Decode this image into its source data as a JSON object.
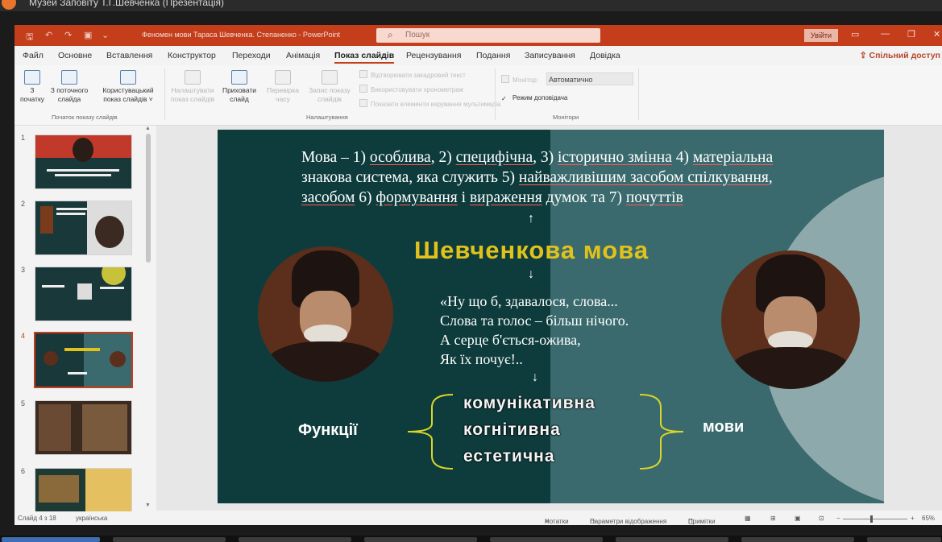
{
  "meeting": {
    "title": "Музей Заповіту Т.Г.Шевченка (Презентація)"
  },
  "app": {
    "doc_title": "Феномен мови Тараса Шевченка. Степаненко  -  PowerPoint",
    "search_placeholder": "Пошук",
    "sign_in": "Увійти"
  },
  "tabs": [
    "Файл",
    "Основне",
    "Вставлення",
    "Конструктор",
    "Переходи",
    "Анімація",
    "Показ слайдів",
    "Рецензування",
    "Подання",
    "Записування",
    "Довідка"
  ],
  "active_tab": "Показ слайдів",
  "share_label": "Спільний доступ",
  "ribbon": {
    "start": {
      "from_beginning": "З\nпочатку",
      "from_current": "З поточного\nслайда",
      "custom": "Користувацький\nпоказ слайдів ˅",
      "group": "Початок показу слайдів"
    },
    "setup": {
      "setup_show": "Налаштувати\nпоказ слайдів",
      "hide_slide": "Приховати\nслайд",
      "rehearse": "Перевірка\nчасу",
      "record": "Запис показу\nслайдів",
      "options": [
        "Відтворювати закадровий текст",
        "Використовувати хронометраж",
        "Показати елементи керування мультимедіа"
      ],
      "group": "Налаштування"
    },
    "monitors": {
      "monitor_label": "Монітор:",
      "monitor_value": "Автоматично",
      "presenter_view": "Режим доповідача",
      "group": "Монітори"
    }
  },
  "thumbnails": [
    {
      "num": "1",
      "selected": false
    },
    {
      "num": "2",
      "selected": false
    },
    {
      "num": "3",
      "selected": false
    },
    {
      "num": "4",
      "selected": true
    },
    {
      "num": "5",
      "selected": false
    },
    {
      "num": "6",
      "selected": false
    }
  ],
  "slide": {
    "line1_prefix": "Мова –  1) ",
    "w1": "особлива",
    "s1": ", 2) ",
    "w2": "специфічна",
    "s2": ", 3) ",
    "w3": "історично змінна",
    "s3": "  4) ",
    "w4": "матеріальна",
    "line2_a": "знакова система, яка служить 5) ",
    "w5": "найважливішим засобом спілкування",
    "s5": ",",
    "w6": "засобом",
    "s6": " 6) ",
    "w7": "формування",
    "s7": " і ",
    "w8": "вираження",
    "s8": " думок та 7) ",
    "w9": "почуттів",
    "heading": "Шевченкова мова",
    "quote": [
      "«Ну що б, здавалося, слова...",
      "Слова та голос – більш нічого.",
      "А серце б'ється-ожива,",
      "Як їх почує!.."
    ],
    "functions_label": "Функції",
    "functions": [
      "комунікативна",
      "когнітивна",
      "естетична"
    ],
    "language_label": "мови",
    "arrow_up": "↑",
    "arrow_down": "↓"
  },
  "status": {
    "slide_info": "Слайд 4 з 18",
    "language": "українська",
    "notes": "Нотатки",
    "display_settings": "Параметри відображення",
    "comments": "Примітки",
    "zoom": "65%"
  }
}
